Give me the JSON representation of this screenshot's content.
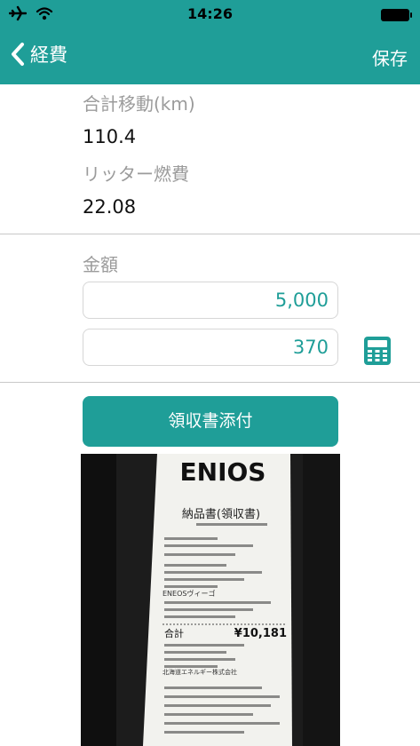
{
  "status_bar": {
    "time": "14:26"
  },
  "nav": {
    "back_label": "経費",
    "save_label": "保存"
  },
  "fields": {
    "distance_label": "合計移動(km)",
    "distance_value": "110.4",
    "fuel_label": "リッター燃費",
    "fuel_value": "22.08"
  },
  "amount": {
    "label": "金額",
    "value1": "5,000",
    "value2": "370"
  },
  "receipt_button_label": "領収書添付",
  "receipt_image": {
    "brand": "ENIOS",
    "doc_title": "納品書(領収書)",
    "total_label": "合計",
    "total_amount": "¥10,181",
    "product": "ENEOSヴィーゴ",
    "company": "北海道エネルギー株式会社"
  },
  "colors": {
    "accent": "#1f9e98",
    "label_gray": "#9b9b9b"
  },
  "icons": [
    "airplane-icon",
    "wifi-icon",
    "battery-icon",
    "chevron-left-icon",
    "calculator-icon"
  ]
}
